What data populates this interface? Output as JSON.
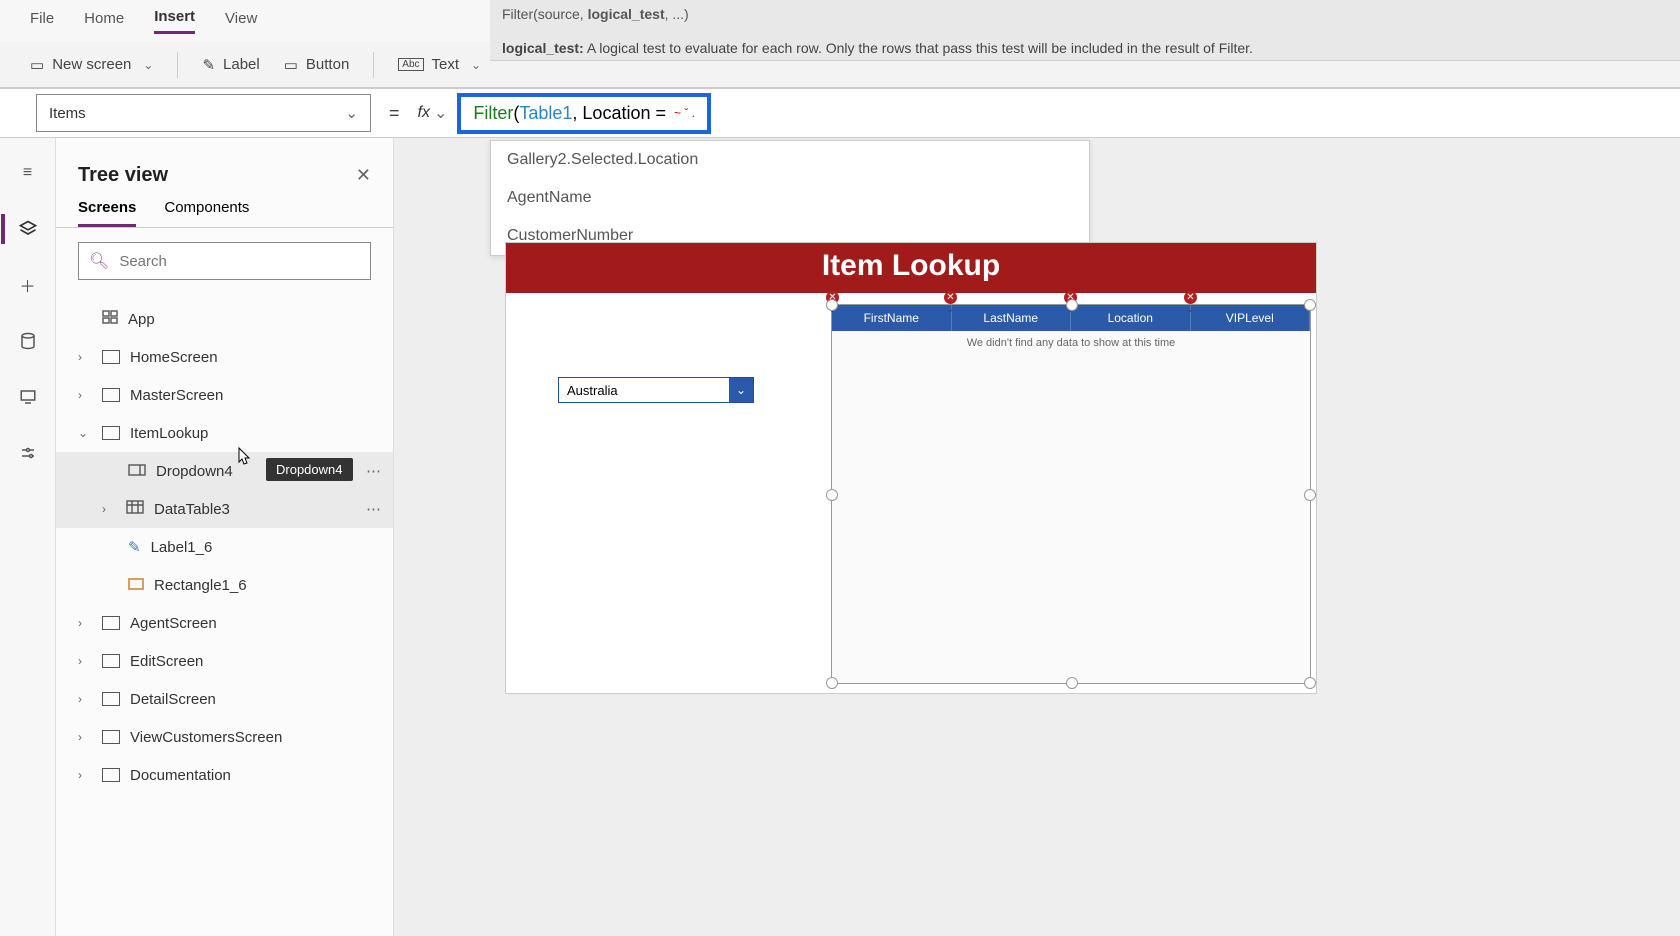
{
  "menu": {
    "file": "File",
    "home": "Home",
    "insert": "Insert",
    "view": "View"
  },
  "ribbon": {
    "newScreen": "New screen",
    "label": "Label",
    "button": "Button",
    "text": "Text"
  },
  "fxHelp": {
    "sigPrefix": "Filter(source, ",
    "sigBold": "logical_test",
    "sigSuffix": ", ...)",
    "descLabel": "logical_test:",
    "descText": " A logical test to evaluate for each row. Only the rows that pass this test will be included in the result of Filter."
  },
  "property": "Items",
  "formula": {
    "fn": "Filter",
    "tbl": "Table1",
    "after": ", Location ="
  },
  "intellisense": {
    "i0": "Gallery2.Selected.Location",
    "i1": "AgentName",
    "i2": "CustomerNumber"
  },
  "treeview": {
    "title": "Tree view",
    "tabs": {
      "screens": "Screens",
      "components": "Components"
    },
    "searchPlaceholder": "Search",
    "nodes": {
      "app": "App",
      "homeScreen": "HomeScreen",
      "masterScreen": "MasterScreen",
      "itemLookup": "ItemLookup",
      "dropdown4": "Dropdown4",
      "dataTable3": "DataTable3",
      "label1_6": "Label1_6",
      "rectangle1_6": "Rectangle1_6",
      "agentScreen": "AgentScreen",
      "editScreen": "EditScreen",
      "detailScreen": "DetailScreen",
      "viewCustomersScreen": "ViewCustomersScreen",
      "documentation": "Documentation"
    },
    "tooltip": "Dropdown4"
  },
  "canvas": {
    "banner": "Item Lookup",
    "dropdownValue": "Australia",
    "columns": {
      "c0": "FirstName",
      "c1": "LastName",
      "c2": "Location",
      "c3": "VIPLevel"
    },
    "emptyMsg": "We didn't find any data to show at this time"
  }
}
